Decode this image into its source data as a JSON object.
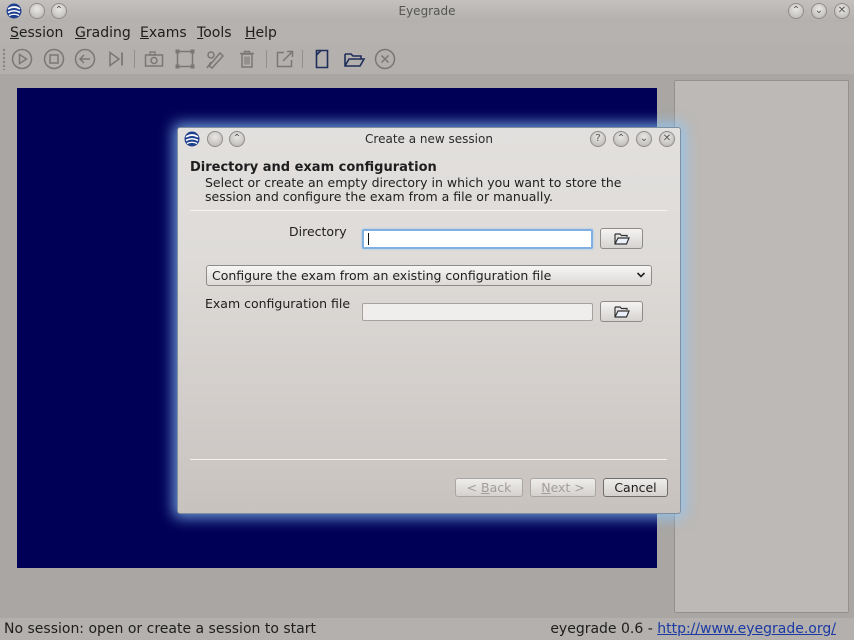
{
  "window": {
    "title": "Eyegrade",
    "minimize_glyph": "⌃",
    "maximize_glyph": "⌄",
    "close_glyph": "✕"
  },
  "menu": {
    "items": [
      {
        "ul": "S",
        "rest": "ession"
      },
      {
        "ul": "G",
        "rest": "rading"
      },
      {
        "ul": "E",
        "rest": "xams"
      },
      {
        "ul": "T",
        "rest": "ools"
      },
      {
        "ul": "H",
        "rest": "elp"
      }
    ]
  },
  "toolbar": {
    "icons": [
      "start-icon",
      "stop-icon",
      "back-icon",
      "skip-icon",
      "snapshot-icon",
      "select-area-icon",
      "edit-icon",
      "discard-icon",
      "export-icon",
      "new-session-icon",
      "open-session-icon",
      "close-session-icon"
    ]
  },
  "dialog": {
    "title": "Create a new session",
    "help_glyph": "?",
    "minimize_glyph": "⌃",
    "maximize_glyph": "⌄",
    "close_glyph": "✕",
    "heading": "Directory and exam configuration",
    "description": "Select or create an empty directory in which you want to store the session and configure the exam from a file or manually.",
    "directory_label": "Directory",
    "directory_value": "",
    "config_mode_selected": "Configure the exam from an existing configuration file",
    "config_file_label": "Exam configuration file",
    "config_file_value": "",
    "buttons": {
      "back": {
        "pre": "< ",
        "ul": "B",
        "rest": "ack"
      },
      "next": {
        "ul": "N",
        "rest": "ext >"
      },
      "cancel": "Cancel"
    }
  },
  "status": {
    "left": "No session: open or create a session to start",
    "version": "eyegrade 0.6 - ",
    "link": "http://www.eyegrade.org/"
  },
  "colors": {
    "canvas": "#000056",
    "focus": "#7fb0e0",
    "glow": "#8cc8ff"
  }
}
